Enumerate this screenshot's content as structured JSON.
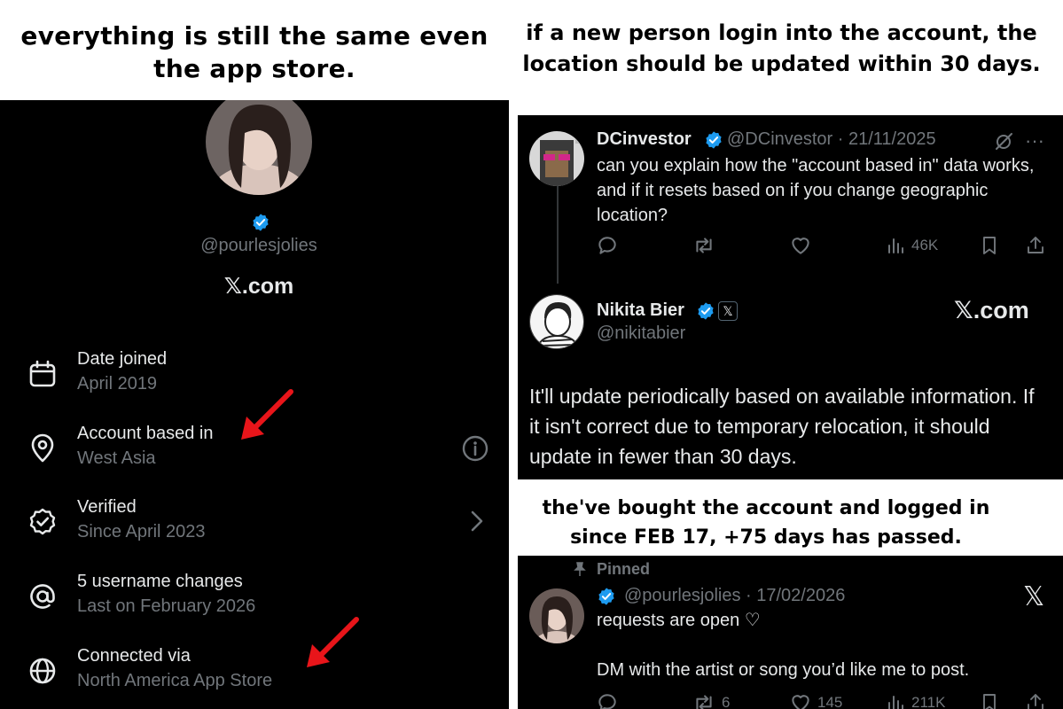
{
  "left_panel": {
    "caption": "everything is still the same even the app store.",
    "handle": "@pourlesjolies",
    "site": "𝕏.com",
    "rows": [
      {
        "label": "Date joined",
        "value": "April 2019",
        "icon": "calendar-icon"
      },
      {
        "label": "Account based in",
        "value": "West Asia",
        "icon": "location-pin-icon"
      },
      {
        "label": "Verified",
        "value": "Since April 2023",
        "icon": "verified-outline-icon"
      },
      {
        "label": "5 username changes",
        "value": "Last on February 2026",
        "icon": "at-sign-icon"
      },
      {
        "label": "Connected via",
        "value": "North America App Store",
        "icon": "globe-icon"
      }
    ]
  },
  "right_panel": {
    "caption_top": "if a new person login into the account, the location should be updated within 30 days.",
    "tweet1": {
      "name": "DCinvestor",
      "handle_date": "@DCinvestor · 21/11/2025",
      "text": "can you explain how the \"account based in\" data works, and if it resets based on if you change geographic location?",
      "views": "46K"
    },
    "tweet2": {
      "name": "Nikita Bier",
      "handle": "@nikitabier",
      "x_badge": "𝕏",
      "site": "𝕏.com",
      "text": "It'll update periodically based on available information. If it isn't correct due to temporary relocation, it should update in fewer than 30 days."
    },
    "caption_mid": "the've bought the account and logged in since FEB 17, +75 days has passed.",
    "tweet3": {
      "pinned": "Pinned",
      "handle_date": "@pourlesjolies · 17/02/2026",
      "line1": "requests are open ♡",
      "line2": "DM with the artist or song you’d like me to post.",
      "x_logo": "𝕏",
      "reposts": "6",
      "likes": "145",
      "views": "211K"
    }
  },
  "colors": {
    "background": "#000000",
    "primary_text": "#e7e9ea",
    "secondary_text": "#71767b",
    "verified_blue": "#1d9bf0",
    "arrow_red": "#e8151a"
  }
}
